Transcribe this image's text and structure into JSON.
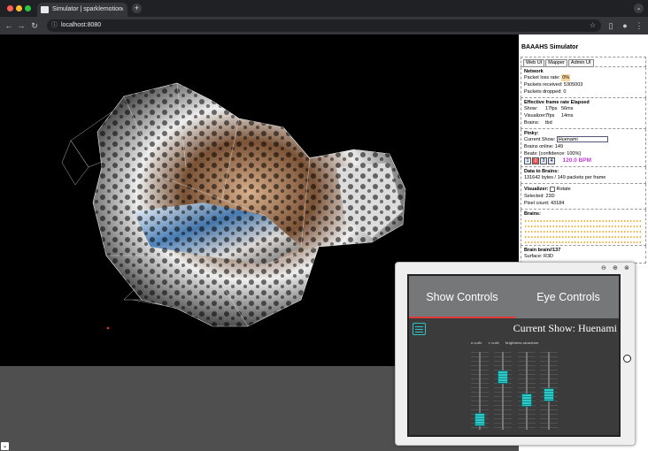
{
  "browser": {
    "tab_title": "Simulator | sparklemotion",
    "url": "localhost:8080",
    "close_glyph": "×",
    "new_tab_glyph": "+",
    "menu_glyph": "⌄"
  },
  "panel": {
    "title": "BAAAHS Simulator",
    "tabs": [
      "Web UI",
      "Mapper",
      "Admin UI"
    ],
    "network": {
      "heading": "Network",
      "packet_loss_label": "Packet loss rate:",
      "packet_loss_value": "0%",
      "received": "Packets received: 5305003",
      "dropped": "Packets dropped: 0"
    },
    "framerate": {
      "heading": "Effective frame rate Elapsed",
      "rows": [
        {
          "name": "Show:",
          "fps": "17fps",
          "ms": "56ms"
        },
        {
          "name": "Visualizer:",
          "fps": "7fps",
          "ms": "14ms"
        },
        {
          "name": "Brains:",
          "fps": "tbd",
          "ms": ""
        }
      ]
    },
    "pinky": {
      "heading": "Pinky:",
      "current_show_label": "Current Show:",
      "current_show_value": "Huenami",
      "brains_online": "Brains online: 149",
      "beats_label": "Beats: [confidence: 100%]",
      "beats": [
        "1",
        "2",
        "3",
        "4"
      ],
      "bpm": "120.0 BPM"
    },
    "data": {
      "heading": "Data to Brains:",
      "line": "131642 bytes / 149 packets per frame"
    },
    "visualizer": {
      "label": "Visualizer:",
      "rotate": "Rotate",
      "selected": "Selected: 23D",
      "pixel_count": "Pixel count: 43184"
    },
    "brains_heading": "Brains:",
    "brain": {
      "title": "Brain brain//137",
      "surface": "Surface: R3D"
    }
  },
  "popup": {
    "icons": [
      "zoom-out",
      "zoom-in",
      "close"
    ],
    "tabs": [
      "Show Controls",
      "Eye Controls"
    ],
    "current_show": "Current Show: Huenami",
    "fader_labels": [
      "u scale",
      "v scale",
      "brightness saturation"
    ]
  },
  "colors": {
    "accent_red": "#e23a3a",
    "fader_cyan": "#2ec9c9",
    "bpm_magenta": "#c03fd6",
    "brain_dot_orange": "#f2a516"
  },
  "sliders": [
    0.08,
    0.72,
    0.38,
    0.45
  ]
}
